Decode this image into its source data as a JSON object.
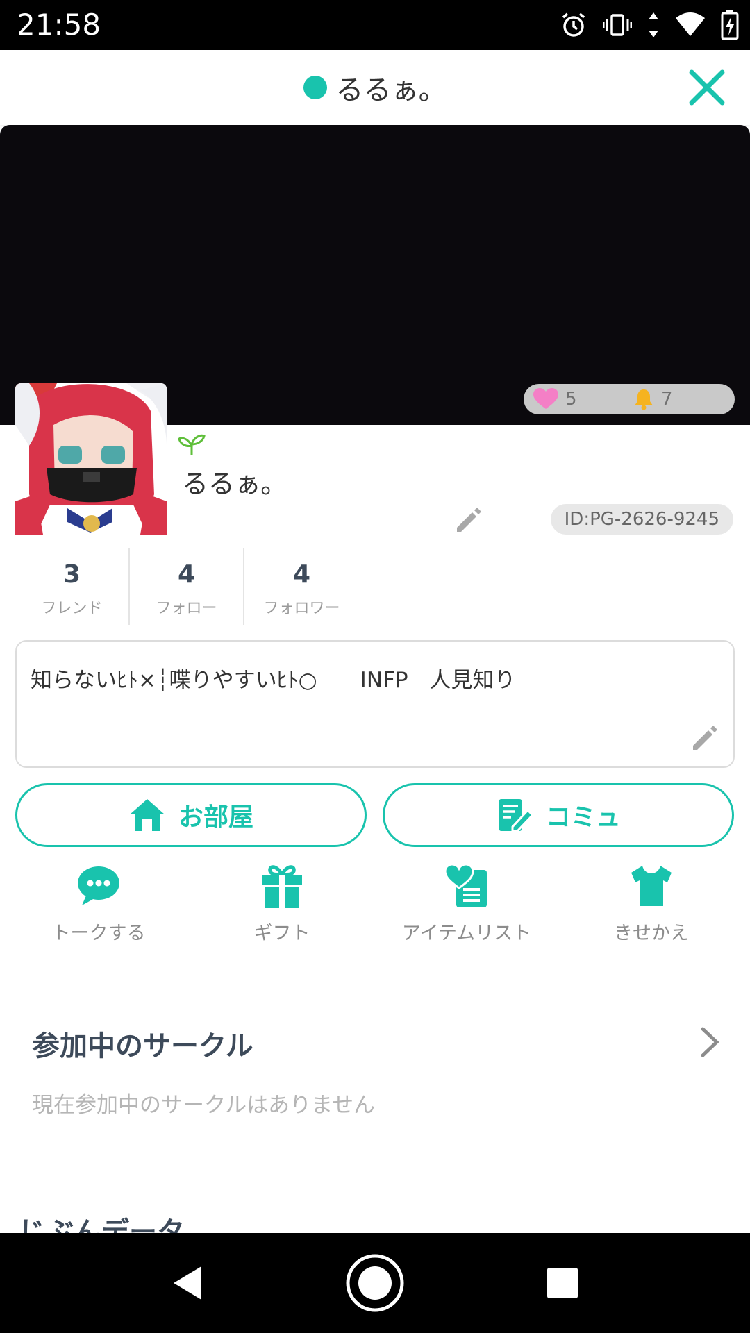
{
  "status_bar": {
    "time": "21:58",
    "icons": [
      "alarm-icon",
      "vibrate-icon",
      "data-arrows-icon",
      "wifi-icon",
      "battery-charging-icon"
    ]
  },
  "header": {
    "title": "るるぁ。",
    "online_dot_color": "#19c3ad",
    "close_icon": "close-icon"
  },
  "profile": {
    "like_count": "5",
    "bell_count": "7",
    "name": "るるぁ。",
    "id_label": "ID:PG-2626-9245",
    "stats": [
      {
        "value": "3",
        "label": "フレンド"
      },
      {
        "value": "4",
        "label": "フォロー"
      },
      {
        "value": "4",
        "label": "フォロワー"
      }
    ],
    "bio": "知らないﾋﾄ×┆喋りやすいﾋﾄ○　　INFP　人見知り"
  },
  "buttons": {
    "room": "お部屋",
    "commu": "コミュ"
  },
  "actions": [
    {
      "label": "トークする",
      "icon": "chat-bubble-icon"
    },
    {
      "label": "ギフト",
      "icon": "gift-icon"
    },
    {
      "label": "アイテムリスト",
      "icon": "item-list-icon"
    },
    {
      "label": "きせかえ",
      "icon": "tshirt-icon"
    }
  ],
  "circles": {
    "title": "参加中のサークル",
    "empty_text": "現在参加中のサークルはありません"
  },
  "next_section": {
    "title": "じぶんデータ"
  },
  "colors": {
    "accent": "#19c3ad",
    "text_dark": "#3d4a5a"
  }
}
